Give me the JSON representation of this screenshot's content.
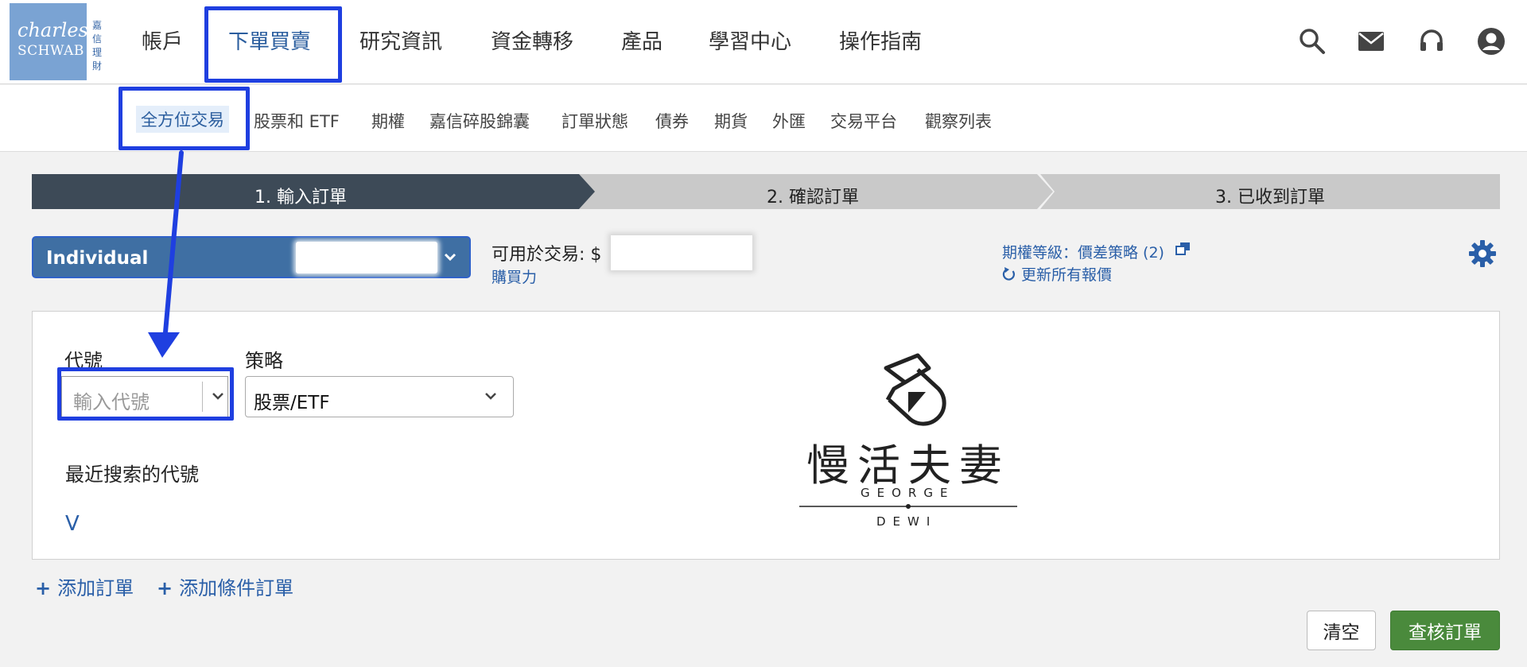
{
  "logo": {
    "line1": "charles",
    "line2": "SCHWAB",
    "cn": "嘉信理財"
  },
  "nav": {
    "items": [
      "帳戶",
      "下單買賣",
      "研究資訊",
      "資金轉移",
      "產品",
      "學習中心",
      "操作指南"
    ],
    "active": "下單買賣"
  },
  "top_icons": [
    "search-icon",
    "mail-icon",
    "headset-icon",
    "user-icon"
  ],
  "subnav": {
    "items": [
      "全方位交易",
      "股票和 ETF",
      "期權",
      "嘉信碎股錦囊",
      "訂單狀態",
      "債券",
      "期貨",
      "外匯",
      "交易平台",
      "觀察列表"
    ],
    "active": "全方位交易"
  },
  "steps": [
    "1. 輸入訂單",
    "2. 確認訂單",
    "3. 已收到訂單"
  ],
  "account": {
    "name": "Individual"
  },
  "available": {
    "label": "可用於交易: $",
    "buying_power": "購買力"
  },
  "options": {
    "level": "期權等級：價差策略 (2)",
    "refresh": "更新所有報價"
  },
  "order": {
    "symbol_label": "代號",
    "symbol_placeholder": "輸入代號",
    "strategy_label": "策略",
    "strategy_value": "股票/ETF",
    "recent_label": "最近搜索的代號",
    "recent_symbol": "V"
  },
  "watermark": {
    "title": "慢活夫妻",
    "line1": "GEORGE",
    "line2": "DEWI"
  },
  "actions": {
    "add_order": "添加訂單",
    "add_conditional": "添加條件訂單",
    "clear": "清空",
    "review": "查核訂單"
  },
  "colors": {
    "accent": "#2a5fa8",
    "highlight": "#1f3fe0",
    "step_active": "#3d4a57",
    "review_btn": "#4a8a3c"
  }
}
